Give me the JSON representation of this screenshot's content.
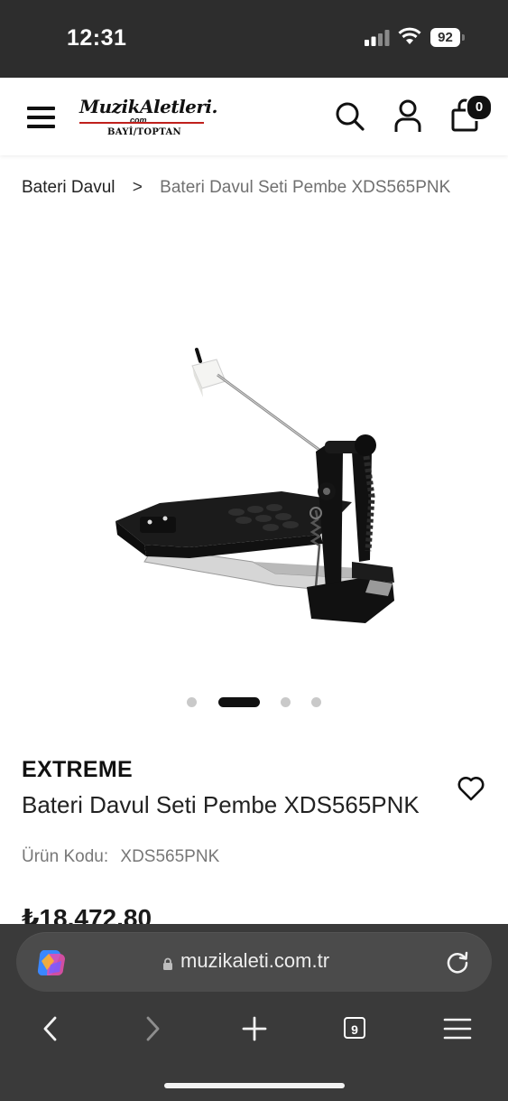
{
  "status_bar": {
    "time": "12:31",
    "battery": "92"
  },
  "header": {
    "logo": {
      "name": "MuzikAletleri.",
      "domain": "com",
      "tagline": "BAYİ/TOPTAN",
      "accent_color": "#c0201c"
    },
    "cart_count": "0",
    "icons": [
      "menu-icon",
      "search-icon",
      "user-icon",
      "cart-icon"
    ]
  },
  "breadcrumb": {
    "root": "Bateri Davul",
    "separator": ">",
    "current": "Bateri Davul Seti Pembe XDS565PNK"
  },
  "gallery": {
    "image": "bass-drum-pedal",
    "slide_count": 4,
    "active_slide": 2
  },
  "product": {
    "brand": "EXTREME",
    "title": "Bateri Davul Seti Pembe XDS565PNK",
    "code_label": "Ürün Kodu:",
    "code_value": "XDS565PNK",
    "price": "₺18.472,80"
  },
  "browser": {
    "url": "muzikaleti.com.tr",
    "tab_count": "9",
    "chrome_color": "#3a3a3a"
  }
}
